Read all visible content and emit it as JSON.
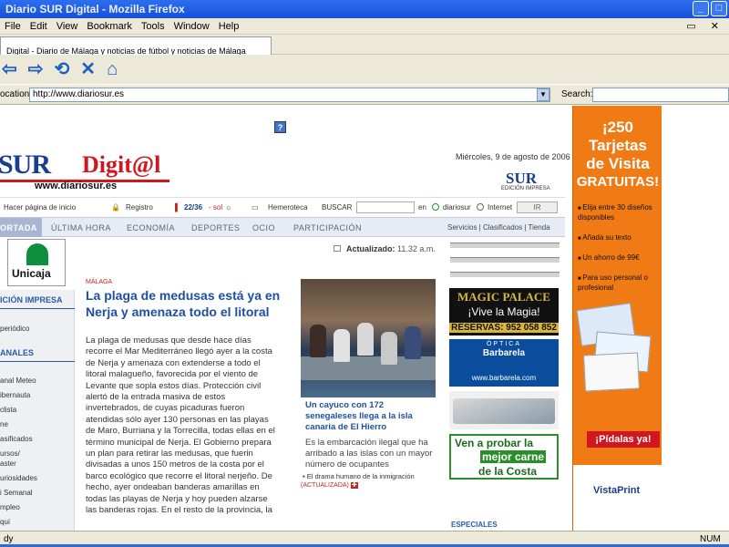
{
  "window": {
    "title": "Diario SUR Digital - Mozilla Firefox"
  },
  "menu": [
    "File",
    "Edit",
    "View",
    "Bookmark",
    "Tools",
    "Window",
    "Help"
  ],
  "tab": {
    "label": "Digital - Diario de Málaga y noticias de fútbol y noticias de Málaga"
  },
  "address": {
    "label": "ocation:",
    "url": "http://www.diariosur.es",
    "search_label": "Search:"
  },
  "site": {
    "logo_sur": "SUR",
    "logo_digital": "Digit@l",
    "site_url": "www.diariosur.es",
    "date": "Miércoles, 9 de agosto de 2006",
    "sur_logo": "SUR",
    "edicion": "EDICIÓN IMPRESA"
  },
  "tools": {
    "home": "Hacer página de inicio",
    "registro": "Registro",
    "temp": "22/36",
    "sol": "- sol",
    "hemeroteca": "Hemeroteca",
    "buscar": "BUSCAR",
    "en": "en",
    "diariosur": "diariosur",
    "internet": "Internet",
    "ir": "IR"
  },
  "nav": {
    "items": [
      "ORTADA",
      "ÚLTIMA HORA",
      "ECONOMÍA",
      "DEPORTES",
      "OCIO",
      "PARTICIPACIÓN"
    ],
    "services": "Servicios | Clasificados | Tienda"
  },
  "left": {
    "unicaja": "Unicaja",
    "sec1": "ICIÓN IMPRESA",
    "item1": "periódico",
    "sec2": "ANALES",
    "items": [
      "anal Meteo",
      "ibernauta",
      "clista",
      "ne",
      "asificados",
      "ursos/",
      "aster",
      "uriosidades",
      "i Semanal",
      "mpleo",
      "quí"
    ]
  },
  "article": {
    "updated_label": "Actualizado:",
    "updated_time": "11.32 a.m.",
    "section": "MÁLAGA",
    "headline": "La plaga de medusas está ya en Nerja y amenaza todo el litoral",
    "body": "La plaga de medusas que desde hace días recorre el Mar Mediterráneo llegó ayer a la costa de Nerja y amenaza con extenderse a todo el litoral malagueño, favorecida por el viento de Levante que sopla estos días. Protección civil alertó de la entrada masiva de estos invertebrados, de cuyas picaduras fueron atendidas sólo ayer 130 personas en las playas de Maro, Burriana y la Torrecilla, todas ellas en el término municipal de Nerja. El Gobierno prepara un plan para retirar las medusas, que fuerin divisadas a unos 150 metros de la costa por el barco ecológico que recorre el litoral nerjeño. De hecho, ayer ondeaban banderas amarillas en todas las playas de Nerja y hoy pueden alzarse las banderas rojas. En el resto de la provincia, la"
  },
  "second": {
    "caption": "Un cayuco con 172 senegaleses llega a la isla canaria de El Hierro",
    "summary": "Es la embarcación ilegal que ha arribado a las islas con un mayor número de ocupantes",
    "related": "El drama humano de la inmigración",
    "actualizada": "(ACTUALIZADA)"
  },
  "ads": {
    "magic1": "MAGIC PALACE",
    "magic2": "¡Vive la Magia!",
    "magic3": "RESERVAS: 952 058 852",
    "optica": "ÓPTICA",
    "barbarela": "Barbarela",
    "barbarela_url": "www.barbarela.com",
    "carne1": "Ven a probar la",
    "carne2": "mejor carne",
    "carne3": "de la Costa",
    "especiales": "ESPECIALES"
  },
  "banner": {
    "line1": "¡250",
    "line2": "Tarjetas",
    "line3": "de Visita",
    "gratuitas": "GRATUITAS!",
    "items": [
      "Elija entre 30 diseños disponibles",
      "Añada su texto",
      "Un ahorro de 99€",
      "Para uso personal o profesional"
    ],
    "cta": "¡Pídalas ya!",
    "brand": "VistaPrint"
  },
  "status": {
    "text": "dy",
    "num": "NUM"
  }
}
